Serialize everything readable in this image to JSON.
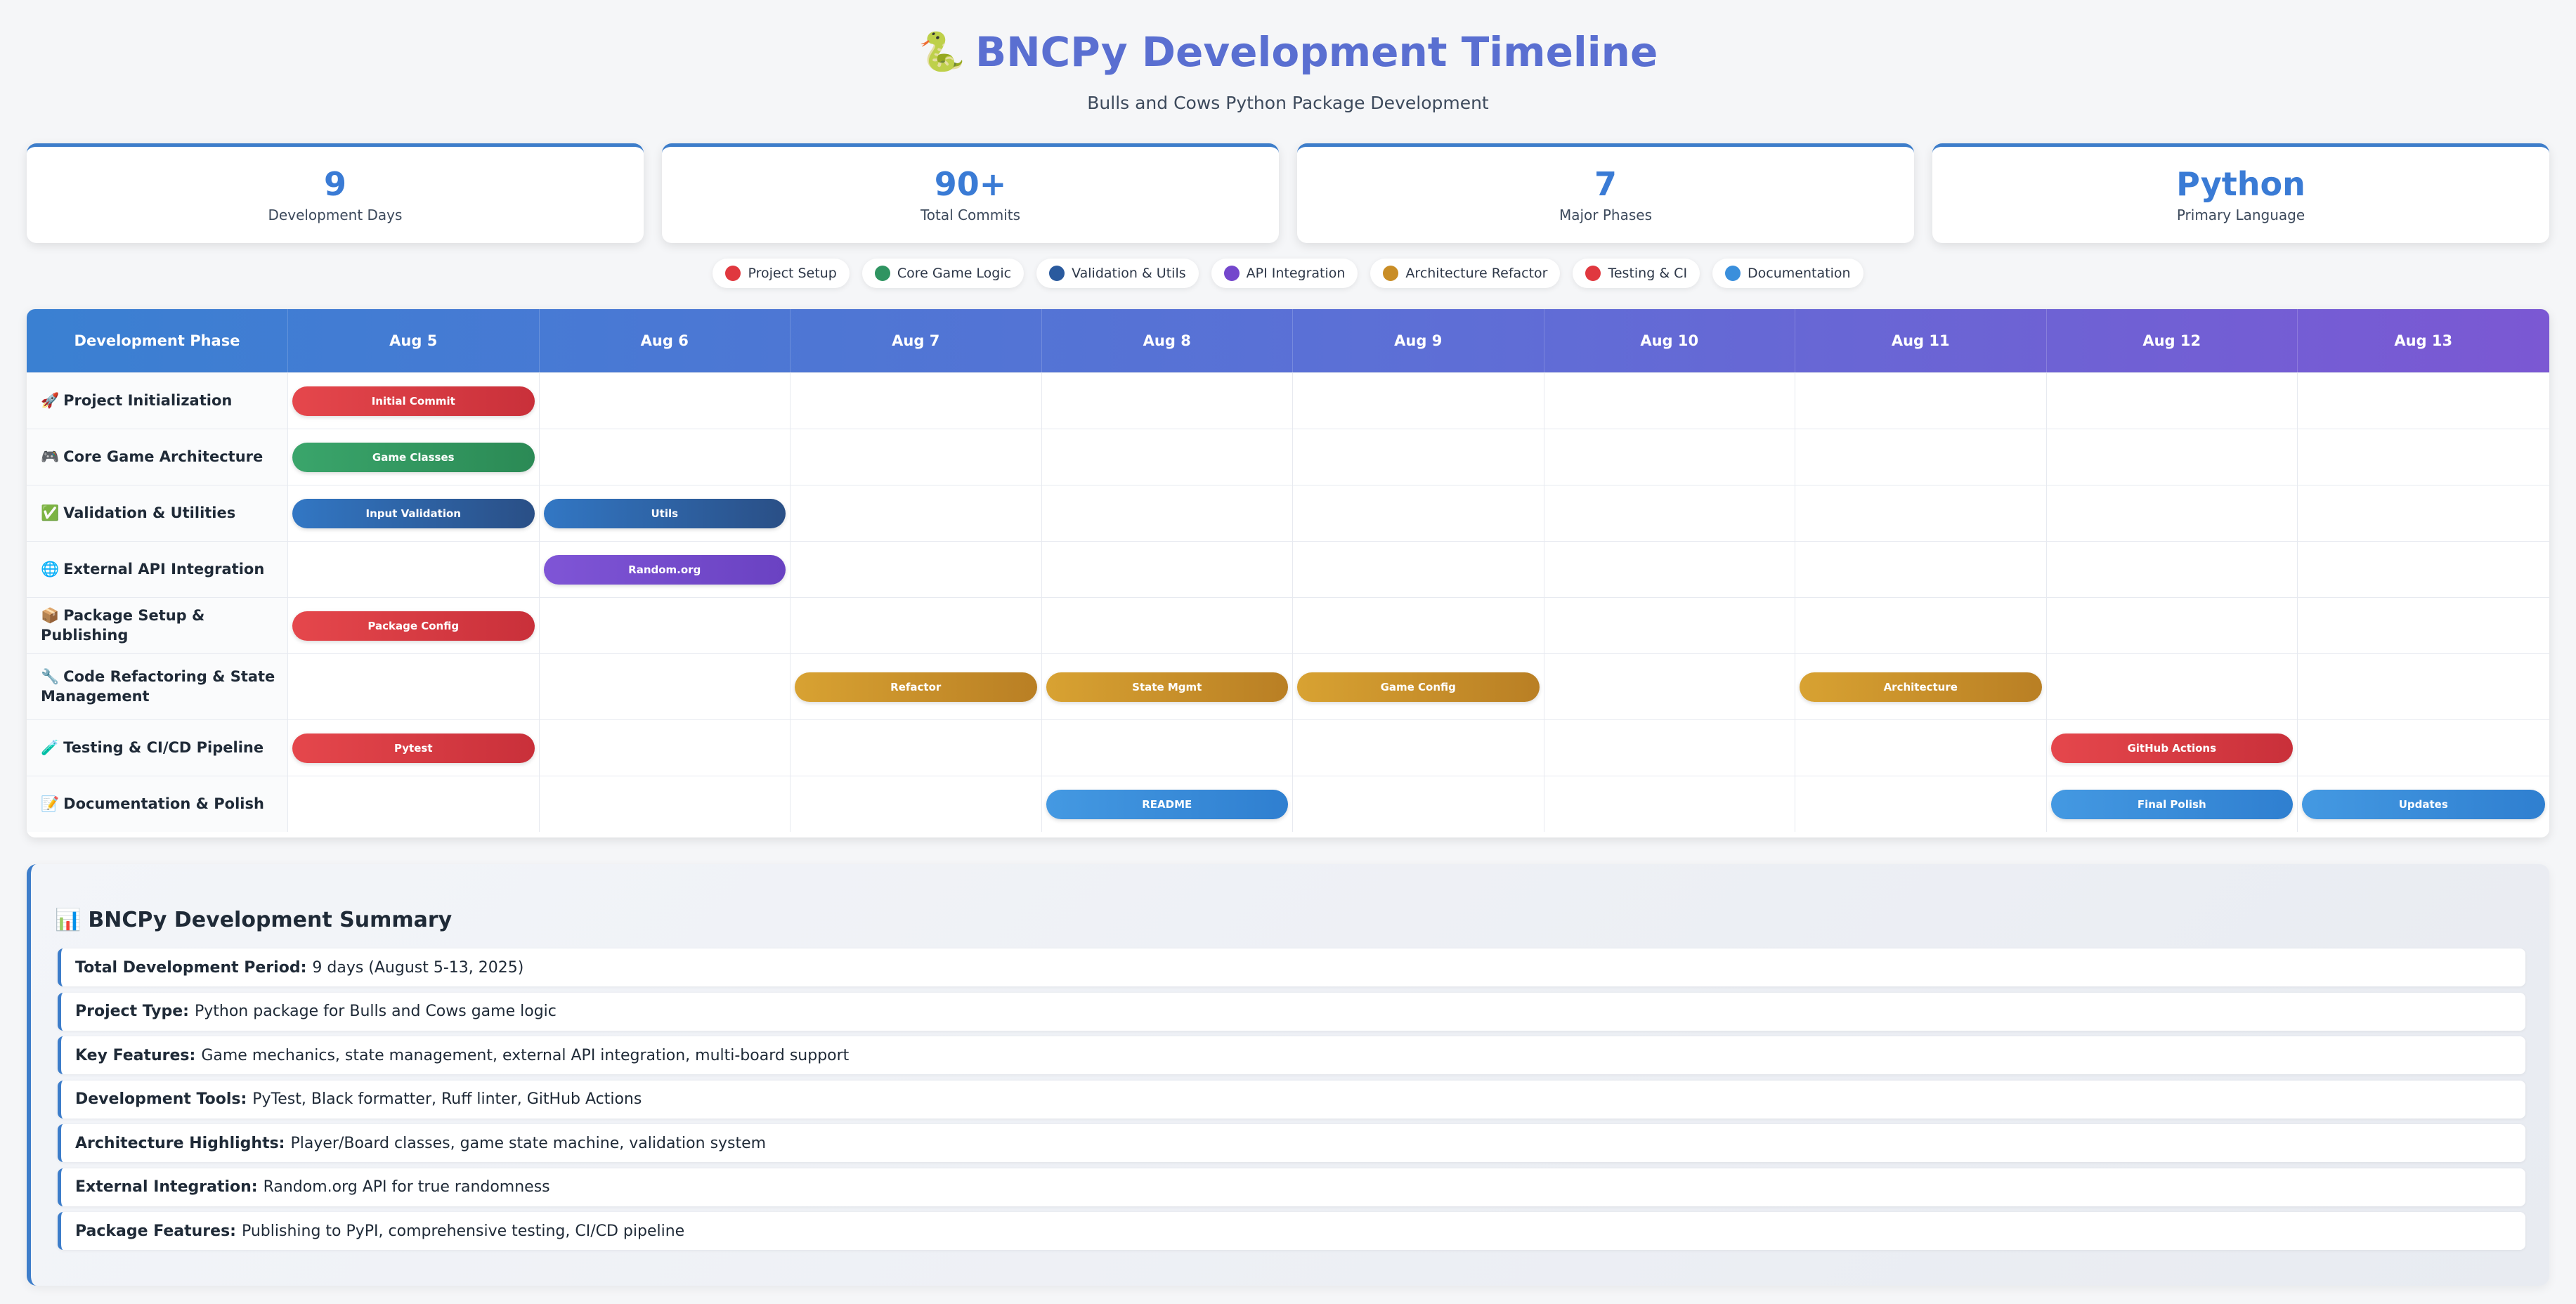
{
  "header": {
    "icon": "🐍",
    "title": "BNCPy Development Timeline",
    "subtitle": "Bulls and Cows Python Package Development"
  },
  "stats": [
    {
      "value": "9",
      "label": "Development Days"
    },
    {
      "value": "90+",
      "label": "Total Commits"
    },
    {
      "value": "7",
      "label": "Major Phases"
    },
    {
      "value": "Python",
      "label": "Primary Language"
    }
  ],
  "legend": [
    {
      "label": "Project Setup",
      "color": "#e0383f"
    },
    {
      "label": "Core Game Logic",
      "color": "#2f9461"
    },
    {
      "label": "Validation & Utils",
      "color": "#2a5a9e"
    },
    {
      "label": "API Integration",
      "color": "#7447cc"
    },
    {
      "label": "Architecture Refactor",
      "color": "#c98d26"
    },
    {
      "label": "Testing & CI",
      "color": "#e0383f"
    },
    {
      "label": "Documentation",
      "color": "#3a8fdc"
    }
  ],
  "timeline": {
    "phase_header": "Development Phase",
    "days": [
      "Aug 5",
      "Aug 6",
      "Aug 7",
      "Aug 8",
      "Aug 9",
      "Aug 10",
      "Aug 11",
      "Aug 12",
      "Aug 13"
    ],
    "rows": [
      {
        "icon": "🚀",
        "phase": "Project Initialization",
        "bars": [
          {
            "day": 0,
            "label": "Initial Commit",
            "kind": "setup"
          }
        ]
      },
      {
        "icon": "🎮",
        "phase": "Core Game Architecture",
        "bars": [
          {
            "day": 0,
            "label": "Game Classes",
            "kind": "core"
          }
        ]
      },
      {
        "icon": "✅",
        "phase": "Validation & Utilities",
        "bars": [
          {
            "day": 0,
            "label": "Input Validation",
            "kind": "valid"
          },
          {
            "day": 1,
            "label": "Utils",
            "kind": "valid"
          }
        ]
      },
      {
        "icon": "🌐",
        "phase": "External API Integration",
        "bars": [
          {
            "day": 1,
            "label": "Random.org",
            "kind": "api"
          }
        ]
      },
      {
        "icon": "📦",
        "phase": "Package Setup & Publishing",
        "bars": [
          {
            "day": 0,
            "label": "Package Config",
            "kind": "setup"
          }
        ]
      },
      {
        "icon": "🔧",
        "phase": "Code Refactoring & State Management",
        "bars": [
          {
            "day": 2,
            "label": "Refactor",
            "kind": "refactor"
          },
          {
            "day": 3,
            "label": "State Mgmt",
            "kind": "refactor"
          },
          {
            "day": 4,
            "label": "Game Config",
            "kind": "refactor"
          },
          {
            "day": 6,
            "label": "Architecture",
            "kind": "refactor"
          }
        ]
      },
      {
        "icon": "🧪",
        "phase": "Testing & CI/CD Pipeline",
        "bars": [
          {
            "day": 0,
            "label": "Pytest",
            "kind": "testing"
          },
          {
            "day": 7,
            "label": "GitHub Actions",
            "kind": "testing"
          }
        ]
      },
      {
        "icon": "📝",
        "phase": "Documentation & Polish",
        "bars": [
          {
            "day": 3,
            "label": "README",
            "kind": "docs"
          },
          {
            "day": 7,
            "label": "Final Polish",
            "kind": "docs"
          },
          {
            "day": 8,
            "label": "Updates",
            "kind": "docs"
          }
        ]
      }
    ]
  },
  "summary": {
    "icon": "📊",
    "title": "BNCPy Development Summary",
    "items": [
      {
        "label": "Total Development Period:",
        "value": "9 days (August 5-13, 2025)"
      },
      {
        "label": "Project Type:",
        "value": "Python package for Bulls and Cows game logic"
      },
      {
        "label": "Key Features:",
        "value": "Game mechanics, state management, external API integration, multi-board support"
      },
      {
        "label": "Development Tools:",
        "value": "PyTest, Black formatter, Ruff linter, GitHub Actions"
      },
      {
        "label": "Architecture Highlights:",
        "value": "Player/Board classes, game state machine, validation system"
      },
      {
        "label": "External Integration:",
        "value": "Random.org API for true randomness"
      },
      {
        "label": "Package Features:",
        "value": "Publishing to PyPI, comprehensive testing, CI/CD pipeline"
      }
    ]
  }
}
